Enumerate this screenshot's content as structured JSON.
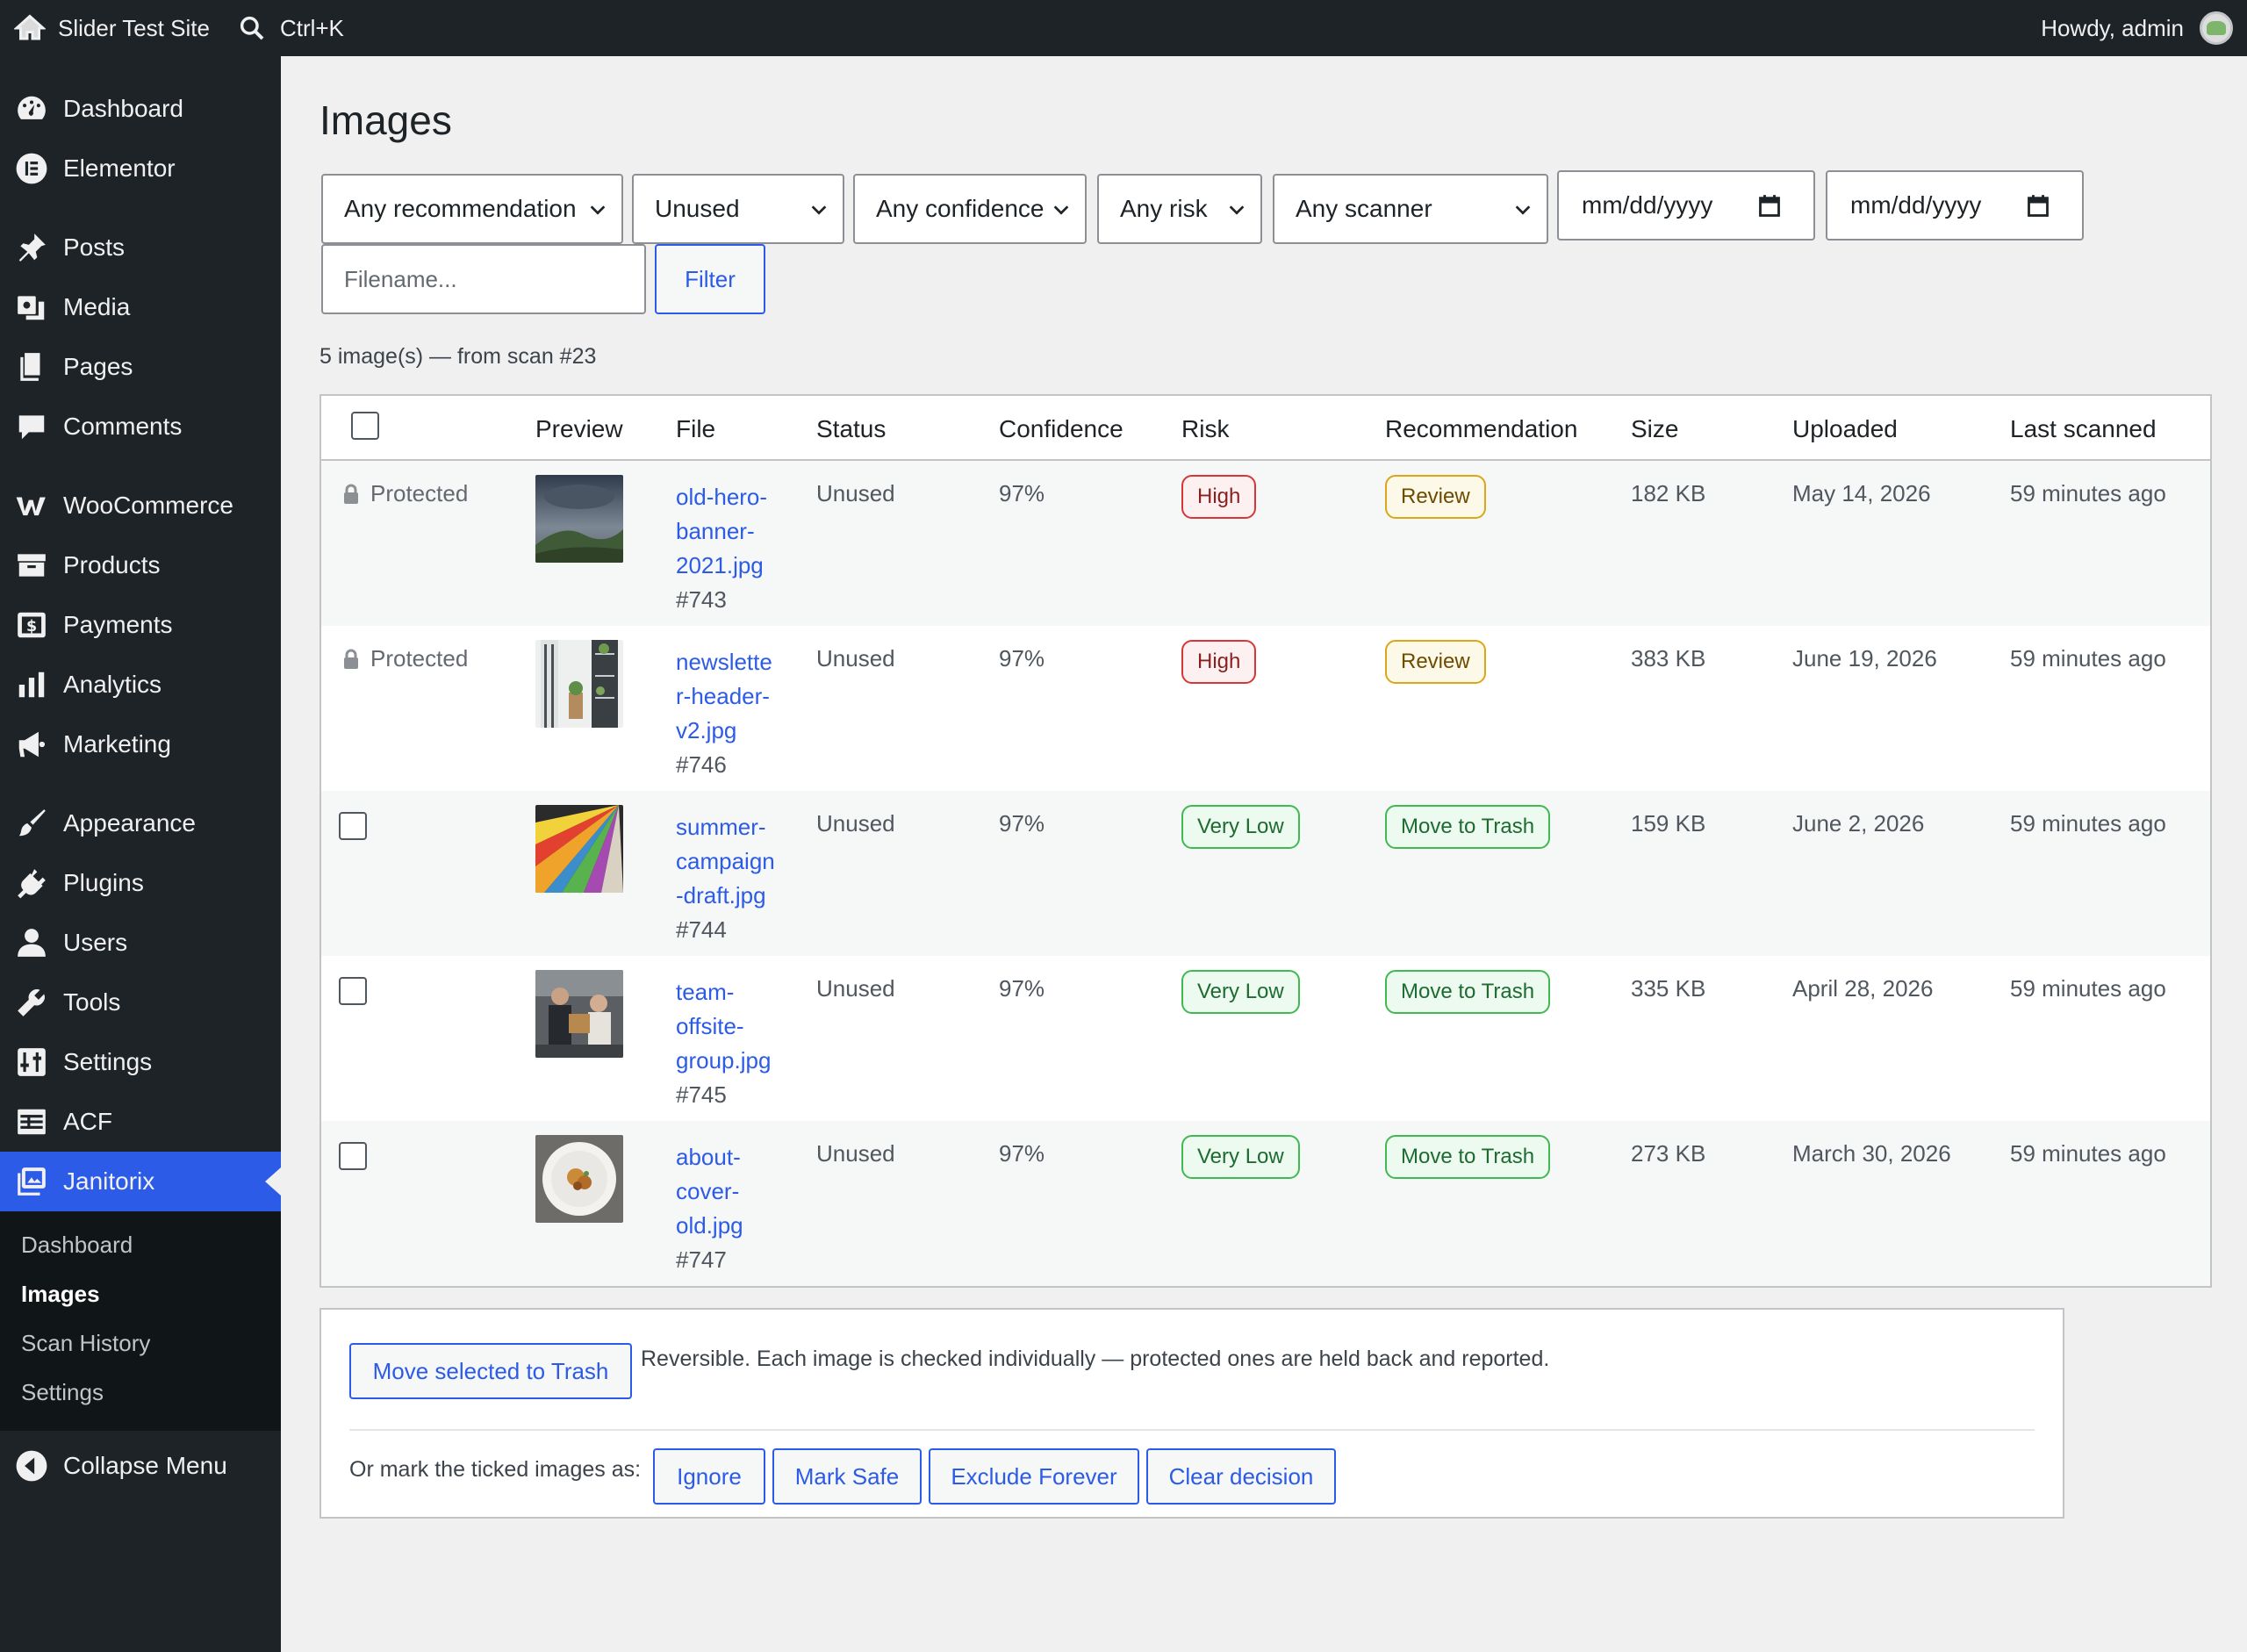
{
  "adminbar": {
    "site_name": "Slider Test Site",
    "search_shortcut": "Ctrl+K",
    "greeting": "Howdy, admin"
  },
  "sidebar": {
    "items": [
      {
        "label": "Dashboard",
        "icon": "dashboard-icon"
      },
      {
        "label": "Elementor",
        "icon": "elementor-icon"
      },
      {
        "label": "Posts",
        "icon": "pin-icon"
      },
      {
        "label": "Media",
        "icon": "media-icon"
      },
      {
        "label": "Pages",
        "icon": "pages-icon"
      },
      {
        "label": "Comments",
        "icon": "comment-icon"
      },
      {
        "label": "WooCommerce",
        "icon": "woocommerce-icon"
      },
      {
        "label": "Products",
        "icon": "products-icon"
      },
      {
        "label": "Payments",
        "icon": "payments-icon"
      },
      {
        "label": "Analytics",
        "icon": "analytics-icon"
      },
      {
        "label": "Marketing",
        "icon": "megaphone-icon"
      },
      {
        "label": "Appearance",
        "icon": "brush-icon"
      },
      {
        "label": "Plugins",
        "icon": "plug-icon"
      },
      {
        "label": "Users",
        "icon": "user-icon"
      },
      {
        "label": "Tools",
        "icon": "wrench-icon"
      },
      {
        "label": "Settings",
        "icon": "settings-icon"
      },
      {
        "label": "ACF",
        "icon": "acf-icon"
      },
      {
        "label": "Janitorix",
        "icon": "janitorix-icon"
      }
    ],
    "submenu": [
      "Dashboard",
      "Images",
      "Scan History",
      "Settings"
    ],
    "collapse": "Collapse Menu"
  },
  "page": {
    "title": "Images",
    "count_text": "5 image(s) — from scan #23"
  },
  "filters": {
    "recommendation": "Any recommendation",
    "status": "Unused",
    "confidence": "Any confidence",
    "risk": "Any risk",
    "scanner": "Any scanner",
    "date_from": "mm/dd/yyyy",
    "date_to": "mm/dd/yyyy",
    "filename_placeholder": "Filename...",
    "filter_button": "Filter"
  },
  "table": {
    "columns": [
      "Preview",
      "File",
      "Status",
      "Confidence",
      "Risk",
      "Recommendation",
      "Size",
      "Uploaded",
      "Last scanned"
    ],
    "rows": [
      {
        "selector": "Protected",
        "file_lines": [
          "old-hero-",
          "banner-",
          "2021.jpg"
        ],
        "id": "#743",
        "status": "Unused",
        "confidence": "97%",
        "risk": "High",
        "recommendation": "Review",
        "size": "182 KB",
        "uploaded": "May 14, 2026",
        "scanned": "59 minutes ago"
      },
      {
        "selector": "Protected",
        "file_lines": [
          "newslette",
          "r-header-",
          "v2.jpg"
        ],
        "id": "#746",
        "status": "Unused",
        "confidence": "97%",
        "risk": "High",
        "recommendation": "Review",
        "size": "383 KB",
        "uploaded": "June 19, 2026",
        "scanned": "59 minutes ago"
      },
      {
        "selector": "",
        "file_lines": [
          "summer-",
          "campaign",
          "-draft.jpg"
        ],
        "id": "#744",
        "status": "Unused",
        "confidence": "97%",
        "risk": "Very Low",
        "recommendation": "Move to Trash",
        "size": "159 KB",
        "uploaded": "June 2, 2026",
        "scanned": "59 minutes ago"
      },
      {
        "selector": "",
        "file_lines": [
          "team-",
          "offsite-",
          "group.jpg"
        ],
        "id": "#745",
        "status": "Unused",
        "confidence": "97%",
        "risk": "Very Low",
        "recommendation": "Move to Trash",
        "size": "335 KB",
        "uploaded": "April 28, 2026",
        "scanned": "59 minutes ago"
      },
      {
        "selector": "",
        "file_lines": [
          "about-",
          "cover-",
          "old.jpg"
        ],
        "id": "#747",
        "status": "Unused",
        "confidence": "97%",
        "risk": "Very Low",
        "recommendation": "Move to Trash",
        "size": "273 KB",
        "uploaded": "March 30, 2026",
        "scanned": "59 minutes ago"
      }
    ]
  },
  "bulk": {
    "trash_button": "Move selected to Trash",
    "note": "Reversible. Each image is checked individually — protected ones are held back and reported.",
    "mark_label": "Or mark the ticked images as:",
    "ignore": "Ignore",
    "mark_safe": "Mark Safe",
    "exclude": "Exclude Forever",
    "clear": "Clear decision"
  },
  "colors": {
    "accent": "#2c5be7",
    "sidebar": "#1d2327",
    "risk_high": "#d63638",
    "review": "#dba617",
    "low": "#3fb950"
  }
}
